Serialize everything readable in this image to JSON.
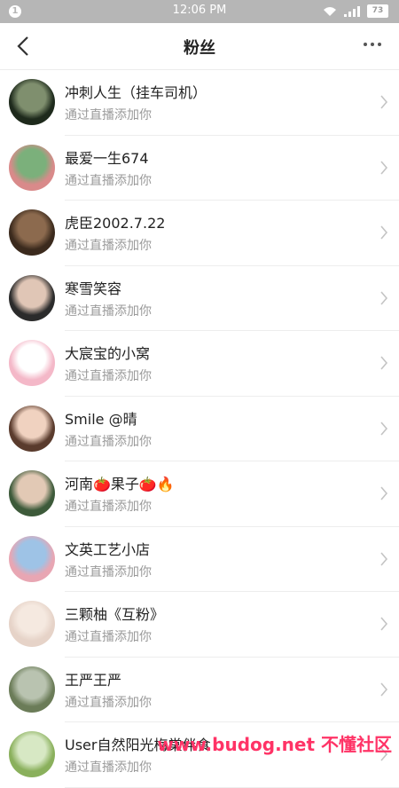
{
  "status_bar": {
    "notification_count": "1",
    "time": "12:06 PM",
    "battery": "73"
  },
  "navbar": {
    "title": "粉丝"
  },
  "followers": [
    {
      "name": "冲刺人生（挂车司机）",
      "subtitle": "通过直播添加你",
      "avatar_colors": [
        "#1e2a1c",
        "#7f8f6e"
      ]
    },
    {
      "name": "最爱一生674",
      "subtitle": "通过直播添加你",
      "avatar_colors": [
        "#d98a8a",
        "#7bb07b"
      ]
    },
    {
      "name": "虎臣2002.7.22",
      "subtitle": "通过直播添加你",
      "avatar_colors": [
        "#3b2a1d",
        "#8c6a4e"
      ]
    },
    {
      "name": "寒雪笑容",
      "subtitle": "通过直播添加你",
      "avatar_colors": [
        "#2b2b2b",
        "#e0c6b6"
      ]
    },
    {
      "name": "大宸宝的小窝",
      "subtitle": "通过直播添加你",
      "avatar_colors": [
        "#f4b8c8",
        "#ffffff"
      ]
    },
    {
      "name": "Smile @晴",
      "subtitle": "通过直播添加你",
      "avatar_colors": [
        "#5a3b2d",
        "#f0d2c0"
      ]
    },
    {
      "name": "河南🍅果子🍅🔥",
      "subtitle": "通过直播添加你",
      "avatar_colors": [
        "#3d5a3a",
        "#e2c9b5"
      ]
    },
    {
      "name": "文英工艺小店",
      "subtitle": "通过直播添加你",
      "avatar_colors": [
        "#e8a6b3",
        "#9ec3e6"
      ]
    },
    {
      "name": "三颗柚《互粉》",
      "subtitle": "通过直播添加你",
      "avatar_colors": [
        "#e6d3c8",
        "#f5e9e0"
      ]
    },
    {
      "name": "王严王严",
      "subtitle": "通过直播添加你",
      "avatar_colors": [
        "#6b7c58",
        "#b9c3b0"
      ]
    },
    {
      "name": "User自然阳光梅棠伴食",
      "subtitle": "通过直播添加你",
      "avatar_colors": [
        "#8ab05c",
        "#d7e8c4"
      ]
    }
  ],
  "watermark": {
    "domain": "www.budog.net",
    "text": "不懂社区"
  }
}
